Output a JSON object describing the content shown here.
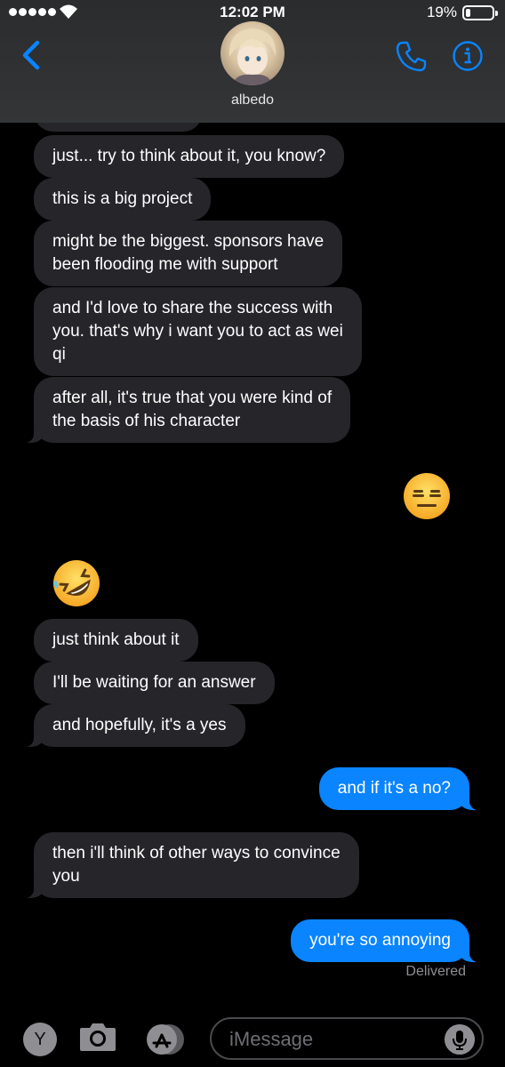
{
  "status_bar": {
    "time": "12:02 PM",
    "battery_percent_label": "19%",
    "battery_level": 0.19,
    "signal_bars": 5
  },
  "header": {
    "contact_name": "albedo",
    "icons": [
      "back-chevron-icon",
      "phone-icon",
      "info-icon"
    ]
  },
  "messages": [
    {
      "from": "them",
      "text": "just... try to think about it, you know?"
    },
    {
      "from": "them",
      "text": "this is a big project"
    },
    {
      "from": "them",
      "text": "might be the biggest. sponsors have\nbeen flooding me with support"
    },
    {
      "from": "them",
      "text": "and I'd love to share the success with\nyou. that's why i want you to act as wei\nqi"
    },
    {
      "from": "them",
      "text": "after all, it's true that you were kind of\nthe basis of his character"
    },
    {
      "from": "me",
      "emoji": "expressionless-face"
    },
    {
      "from": "them",
      "emoji": "rolling-on-the-floor-laughing"
    },
    {
      "from": "them",
      "text": "just think about it"
    },
    {
      "from": "them",
      "text": "I'll be waiting for an answer"
    },
    {
      "from": "them",
      "text": "and hopefully, it's a yes"
    },
    {
      "from": "me",
      "text": "and if it's a no?"
    },
    {
      "from": "them",
      "text": "then i'll think of other ways to convince\nyou"
    },
    {
      "from": "me",
      "text": "you're so annoying"
    }
  ],
  "delivery_status": "Delivered",
  "input_bar": {
    "y_app_label": "Y",
    "placeholder": "iMessage",
    "icons": [
      "camera-icon",
      "app-store-icon",
      "microphone-icon"
    ]
  },
  "colors": {
    "incoming_bubble": "#26252a",
    "outgoing_bubble": "#0a84ff",
    "accent": "#0a84ff",
    "background": "#000000"
  }
}
